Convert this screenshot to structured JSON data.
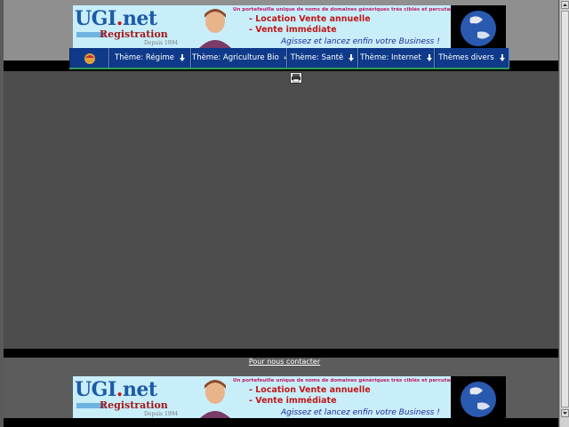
{
  "banner": {
    "logo_main": "UGI",
    "logo_dot": ".",
    "logo_main_suffix": "net",
    "logo_sub": "Registration",
    "logo_since": "Depuis 1994",
    "tagline": "Un portefeuille unique de noms de domaines génériques très ciblés et percutants !",
    "line1": "- Location Vente annuelle",
    "line2": "- Vente immédiate",
    "slogan": "Agissez et lancez enfin votre Business !"
  },
  "nav": {
    "items": [
      {
        "label": "Thème: Régime"
      },
      {
        "label": "Thème: Agriculture Bio"
      },
      {
        "label": "Thème: Santé"
      },
      {
        "label": "Thème: Internet"
      },
      {
        "label": "Thèmes divers"
      }
    ]
  },
  "footer": {
    "contact_label": "Pour nous contacter"
  },
  "colors": {
    "nav_bg": "#0f3a8a",
    "banner_bg": "#c8eefa",
    "accent_red": "#c01818",
    "accent_blue": "#1e5aa8"
  },
  "icons": {
    "home": "home-icon",
    "arrow": "arrow-down-icon",
    "print": "print-icon"
  }
}
